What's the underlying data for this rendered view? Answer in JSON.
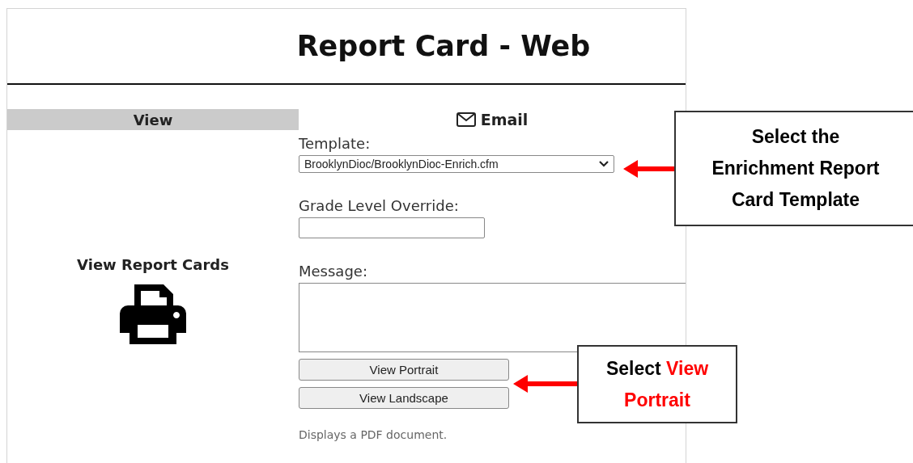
{
  "page": {
    "title": "Report Card - Web"
  },
  "view_panel": {
    "header": "View",
    "link": "View Report Cards"
  },
  "email_panel": {
    "header": "Email",
    "template_label": "Template:",
    "template_value": "BrooklynDioc/BrooklynDioc-Enrich.cfm",
    "grade_label": "Grade Level Override:",
    "message_label": "Message:",
    "buttons": [
      "View Portrait",
      "View Landscape"
    ],
    "note": "Displays a PDF document."
  },
  "callouts": [
    {
      "parts": [
        {
          "text": "Select the Enrichment Report Card Template",
          "highlight": false
        }
      ]
    },
    {
      "parts": [
        {
          "text": "Select ",
          "highlight": false
        },
        {
          "text": "View Portrait",
          "highlight": true
        }
      ]
    }
  ]
}
